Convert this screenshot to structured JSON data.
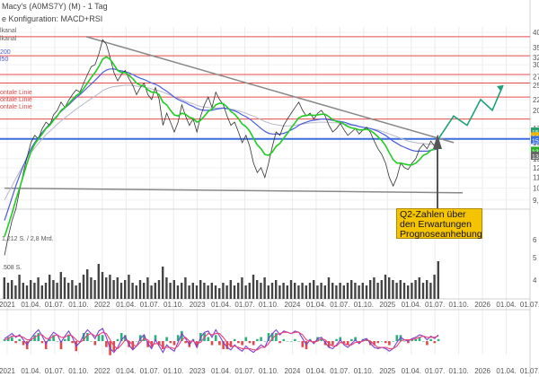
{
  "header": {
    "title": "Macy's (A0MS7Y) (M) - 1 Tag",
    "config": "e Konfiguration: MACD+RSI"
  },
  "legend_left": [
    "lkanal",
    "lkanal",
    "200",
    "l50",
    "ontale Linie",
    "ontale Linie",
    "ontale Linie"
  ],
  "volume_label": "1,212 S. / 2,8 Mrd.",
  "volume_sub": ".508 S.",
  "annotation": "Q2-Zahlen über den Erwartungen Prognoseanhebung",
  "colors": {
    "price": "#333333",
    "sma_fast": "#22cc22",
    "sma_mid": "#4c5ce0",
    "sma_slow": "#b8b8c8",
    "hline": "#e64b4b",
    "support": "#3a6fd8",
    "trend": "#888888",
    "forecast": "#1fa07a",
    "annotation_bg": "#f5c400",
    "macd": "#7a3fd0",
    "signal": "#e8427a"
  },
  "chart_data": {
    "type": "line",
    "x_ticks": [
      "2021",
      "01.04.",
      "01.07.",
      "01.10.",
      "2022",
      "01.04.",
      "01.07.",
      "01.10.",
      "2023",
      "01.04.",
      "01.07.",
      "01.10.",
      "2024",
      "01.04.",
      "01.07.",
      "01.10.",
      "2025",
      "01.04.",
      "01.07.",
      "01.10.",
      "2026",
      "01.04.",
      "01.07."
    ],
    "y_ticks_price": [
      "40",
      "35",
      "32",
      "30",
      "27",
      "25",
      "22",
      "20",
      "17",
      "15",
      "13",
      "12",
      "11",
      "10",
      "9,0"
    ],
    "y_ticks_volume": [
      "6",
      "5",
      "4"
    ],
    "ylim": [
      8.5,
      42
    ],
    "horizontal_lines": [
      38.5,
      32.5,
      27.5,
      25.5,
      22.5,
      18.5
    ],
    "support_line": 15.5,
    "trend_lines": [
      {
        "from": [
          "Nov 2021",
          38.5
        ],
        "to": [
          "Sep 2025",
          15.0
        ]
      },
      {
        "from": [
          "Jan 2021",
          10.0
        ],
        "to": [
          "Sep 2025",
          9.6
        ]
      }
    ],
    "forecast": [
      15.5,
      19.0,
      17.5,
      22.0,
      20.0,
      25.0
    ],
    "price": [
      5.5,
      6.5,
      7.5,
      8.3,
      9.8,
      11.5,
      13.2,
      15.0,
      16.0,
      15.5,
      17.0,
      18.0,
      17.5,
      19.2,
      20.0,
      21.5,
      20.5,
      21.8,
      23.0,
      24.0,
      23.5,
      25.5,
      27.5,
      29.5,
      30.0,
      33.0,
      37.5,
      36.0,
      32.0,
      28.0,
      26.0,
      27.5,
      28.5,
      26.5,
      25.0,
      23.0,
      24.5,
      25.5,
      23.0,
      22.0,
      24.5,
      22.0,
      17.5,
      19.5,
      18.0,
      16.5,
      18.0,
      21.0,
      19.0,
      17.5,
      18.5,
      16.5,
      19.0,
      21.0,
      22.5,
      20.5,
      23.5,
      22.0,
      21.0,
      19.0,
      17.5,
      18.0,
      16.5,
      15.0,
      16.0,
      14.5,
      12.5,
      11.5,
      12.0,
      11.0,
      12.5,
      14.5,
      16.5,
      16.0,
      17.5,
      18.5,
      19.5,
      20.5,
      21.5,
      20.0,
      19.0,
      19.5,
      18.5,
      19.5,
      20.0,
      19.0,
      17.5,
      16.5,
      17.0,
      17.8,
      16.8,
      16.0,
      16.5,
      17.0,
      16.2,
      16.8,
      17.2,
      16.4,
      15.2,
      14.2,
      13.5,
      12.5,
      11.0,
      10.2,
      11.0,
      12.5,
      12.0,
      11.8,
      12.5,
      13.0,
      14.2,
      14.8,
      14.2,
      15.2,
      14.5,
      16.0
    ],
    "sma_fast": [
      6.5,
      7.2,
      8.0,
      9.0,
      10.0,
      11.2,
      12.5,
      13.8,
      14.8,
      15.5,
      16.2,
      17.0,
      17.5,
      18.3,
      19.0,
      20.0,
      20.5,
      21.2,
      22.0,
      22.8,
      23.3,
      24.3,
      25.5,
      26.8,
      28.0,
      29.5,
      31.5,
      32.2,
      31.5,
      30.0,
      28.5,
      28.0,
      28.0,
      27.3,
      26.5,
      25.5,
      25.0,
      24.8,
      24.0,
      23.5,
      23.5,
      23.0,
      21.5,
      21.0,
      20.0,
      19.2,
      19.0,
      19.5,
      19.3,
      18.8,
      18.6,
      18.0,
      18.3,
      19.0,
      19.8,
      20.2,
      21.0,
      21.3,
      21.2,
      20.6,
      19.8,
      19.3,
      18.6,
      17.7,
      17.3,
      16.6,
      15.6,
      14.7,
      14.2,
      13.5,
      13.4,
      13.8,
      14.5,
      14.9,
      15.6,
      16.3,
      17.1,
      17.9,
      18.7,
      19.0,
      19.1,
      19.2,
      19.1,
      19.2,
      19.3,
      19.3,
      18.9,
      18.4,
      18.1,
      18.0,
      17.7,
      17.3,
      17.1,
      17.0,
      16.8,
      16.8,
      16.9,
      16.7,
      16.3,
      15.8,
      15.3,
      14.6,
      13.7,
      12.9,
      12.5,
      12.5,
      12.4,
      12.3,
      12.3,
      12.5,
      12.9,
      13.4,
      13.6,
      14.0,
      14.2,
      14.6
    ],
    "sma_mid": [
      7.5,
      8.3,
      9.2,
      10.2,
      11.2,
      12.2,
      13.2,
      14.2,
      15.0,
      15.7,
      16.4,
      17.1,
      17.7,
      18.4,
      19.1,
      19.8,
      20.4,
      21.0,
      21.7,
      22.4,
      23.0,
      23.7,
      24.5,
      25.3,
      26.1,
      27.0,
      28.0,
      28.6,
      28.9,
      28.9,
      28.6,
      28.4,
      28.2,
      27.9,
      27.5,
      27.0,
      26.6,
      26.3,
      25.9,
      25.5,
      25.2,
      24.8,
      24.2,
      23.7,
      23.1,
      22.5,
      22.0,
      21.7,
      21.4,
      21.0,
      20.7,
      20.3,
      20.1,
      20.0,
      20.0,
      20.0,
      20.2,
      20.3,
      20.4,
      20.3,
      20.1,
      19.9,
      19.6,
      19.2,
      18.9,
      18.5,
      18.0,
      17.5,
      17.0,
      16.6,
      16.3,
      16.2,
      16.2,
      16.2,
      16.3,
      16.5,
      16.8,
      17.1,
      17.5,
      17.8,
      18.0,
      18.2,
      18.3,
      18.4,
      18.5,
      18.5,
      18.4,
      18.3,
      18.2,
      18.1,
      18.0,
      17.8,
      17.6,
      17.5,
      17.3,
      17.2,
      17.1,
      17.0,
      16.8,
      16.6,
      16.3,
      16.0,
      15.6,
      15.2,
      14.9,
      14.6,
      14.4,
      14.2,
      14.0,
      13.9,
      13.9,
      13.9,
      13.9,
      14.0,
      14.1,
      14.2
    ],
    "sma_slow": [
      9.0,
      9.6,
      10.2,
      10.9,
      11.6,
      12.3,
      13.0,
      13.7,
      14.3,
      14.9,
      15.5,
      16.1,
      16.6,
      17.1,
      17.7,
      18.2,
      18.7,
      19.2,
      19.7,
      20.2,
      20.7,
      21.2,
      21.7,
      22.2,
      22.7,
      23.2,
      23.8,
      24.2,
      24.5,
      24.7,
      24.8,
      24.9,
      25.0,
      25.0,
      24.9,
      24.8,
      24.7,
      24.6,
      24.4,
      24.2,
      24.0,
      23.8,
      23.5,
      23.2,
      22.9,
      22.6,
      22.3,
      22.0,
      21.7,
      21.4,
      21.2,
      20.9,
      20.7,
      20.6,
      20.5,
      20.4,
      20.4,
      20.4,
      20.4,
      20.3,
      20.2,
      20.1,
      19.9,
      19.7,
      19.5,
      19.2,
      19.0,
      18.7,
      18.4,
      18.1,
      17.9,
      17.7,
      17.6,
      17.5,
      17.4,
      17.4,
      17.4,
      17.5,
      17.6,
      17.7,
      17.8,
      17.9,
      17.9,
      18.0,
      18.0,
      18.0,
      18.0,
      17.9,
      17.9,
      17.8,
      17.7,
      17.6,
      17.5,
      17.4,
      17.3,
      17.2,
      17.1,
      17.0,
      16.9,
      16.8,
      16.6,
      16.4,
      16.2,
      16.0,
      15.8,
      15.6,
      15.4,
      15.2,
      15.1,
      15.0,
      14.9,
      14.9,
      14.8,
      14.8,
      14.8,
      14.8
    ],
    "volume": [
      0.8,
      0.6,
      0.7,
      0.5,
      0.9,
      0.6,
      0.5,
      0.7,
      0.6,
      0.8,
      0.5,
      0.6,
      0.9,
      0.7,
      0.6,
      1.0,
      0.8,
      0.6,
      0.7,
      0.5,
      0.6,
      0.9,
      1.1,
      0.8,
      0.7,
      1.3,
      1.0,
      0.8,
      0.9,
      0.7,
      0.8,
      0.6,
      0.7,
      0.9,
      0.6,
      0.5,
      0.7,
      0.6,
      0.8,
      0.5,
      0.6,
      0.7,
      1.2,
      0.8,
      0.6,
      0.7,
      0.5,
      0.6,
      0.8,
      0.5,
      0.6,
      0.5,
      0.7,
      0.6,
      0.5,
      0.6,
      0.5,
      0.4,
      0.6,
      0.5,
      0.7,
      0.5,
      0.6,
      0.8,
      0.5,
      0.6,
      0.9,
      0.7,
      0.6,
      0.8,
      0.5,
      0.6,
      0.7,
      0.5,
      0.6,
      0.5,
      0.7,
      0.6,
      0.5,
      0.6,
      0.5,
      0.6,
      0.7,
      0.5,
      0.6,
      0.5,
      0.8,
      0.6,
      0.5,
      0.6,
      0.5,
      0.6,
      0.7,
      0.6,
      0.5,
      0.6,
      0.5,
      0.7,
      0.8,
      0.6,
      0.7,
      0.9,
      0.8,
      0.7,
      0.6,
      0.7,
      0.6,
      0.5,
      0.6,
      0.7,
      0.8,
      0.6,
      0.7,
      0.6,
      0.9,
      1.4
    ],
    "macd": [
      0.2,
      0.4,
      0.6,
      0.3,
      0.5,
      0.1,
      -0.3,
      0.2,
      0.6,
      0.9,
      0.4,
      -0.2,
      0.3,
      0.7,
      0.5,
      -0.1,
      0.4,
      0.8,
      0.3,
      -0.4,
      -0.1,
      0.5,
      0.9,
      0.6,
      0.2,
      0.8,
      1.0,
      0.3,
      -0.6,
      -0.9,
      -0.5,
      0.1,
      0.4,
      -0.3,
      -0.7,
      -0.4,
      0.2,
      0.5,
      -0.2,
      -0.6,
      0.1,
      -0.4,
      -0.9,
      -0.3,
      -0.6,
      -0.8,
      -0.1,
      0.6,
      0.2,
      -0.3,
      0.1,
      -0.5,
      0.3,
      0.7,
      0.8,
      0.3,
      0.9,
      0.4,
      -0.1,
      -0.5,
      -0.7,
      -0.3,
      -0.6,
      -0.8,
      -0.4,
      -0.7,
      -0.9,
      -0.6,
      -0.3,
      -0.5,
      0.2,
      0.6,
      0.9,
      0.5,
      0.8,
      0.7,
      0.6,
      0.8,
      0.7,
      0.2,
      -0.3,
      0.1,
      -0.2,
      0.2,
      0.3,
      -0.1,
      -0.5,
      -0.6,
      -0.3,
      0.1,
      -0.3,
      -0.5,
      -0.2,
      0.1,
      -0.2,
      0.1,
      0.2,
      -0.2,
      -0.5,
      -0.6,
      -0.5,
      -0.6,
      -0.8,
      -0.6,
      -0.1,
      0.3,
      0.1,
      0.0,
      0.2,
      0.3,
      0.5,
      0.4,
      0.1,
      0.4,
      0.2,
      0.5
    ],
    "signal": [
      0.1,
      0.2,
      0.4,
      0.4,
      0.4,
      0.3,
      0.1,
      0.1,
      0.3,
      0.5,
      0.5,
      0.2,
      0.2,
      0.4,
      0.5,
      0.3,
      0.3,
      0.5,
      0.4,
      0.1,
      -0.1,
      0.1,
      0.5,
      0.6,
      0.4,
      0.5,
      0.7,
      0.6,
      0.1,
      -0.4,
      -0.6,
      -0.3,
      0.1,
      0.0,
      -0.3,
      -0.4,
      -0.1,
      0.2,
      0.1,
      -0.3,
      -0.2,
      -0.2,
      -0.5,
      -0.5,
      -0.5,
      -0.6,
      -0.4,
      0.1,
      0.3,
      0.0,
      0.0,
      -0.2,
      -0.1,
      0.3,
      0.6,
      0.5,
      0.6,
      0.6,
      0.3,
      -0.1,
      -0.4,
      -0.4,
      -0.5,
      -0.6,
      -0.6,
      -0.6,
      -0.7,
      -0.7,
      -0.5,
      -0.5,
      -0.2,
      0.2,
      0.5,
      0.6,
      0.7,
      0.7,
      0.6,
      0.7,
      0.7,
      0.5,
      0.1,
      0.0,
      -0.1,
      0.0,
      0.2,
      0.1,
      -0.2,
      -0.4,
      -0.4,
      -0.1,
      -0.2,
      -0.3,
      -0.3,
      -0.1,
      -0.1,
      0.0,
      0.1,
      0.0,
      -0.3,
      -0.5,
      -0.5,
      -0.5,
      -0.6,
      -0.6,
      -0.4,
      0.0,
      0.1,
      0.1,
      0.1,
      0.2,
      0.3,
      0.4,
      0.3,
      0.3,
      0.3,
      0.4
    ],
    "right_labels": [
      "15",
      "16",
      "15",
      "13",
      "13"
    ]
  }
}
